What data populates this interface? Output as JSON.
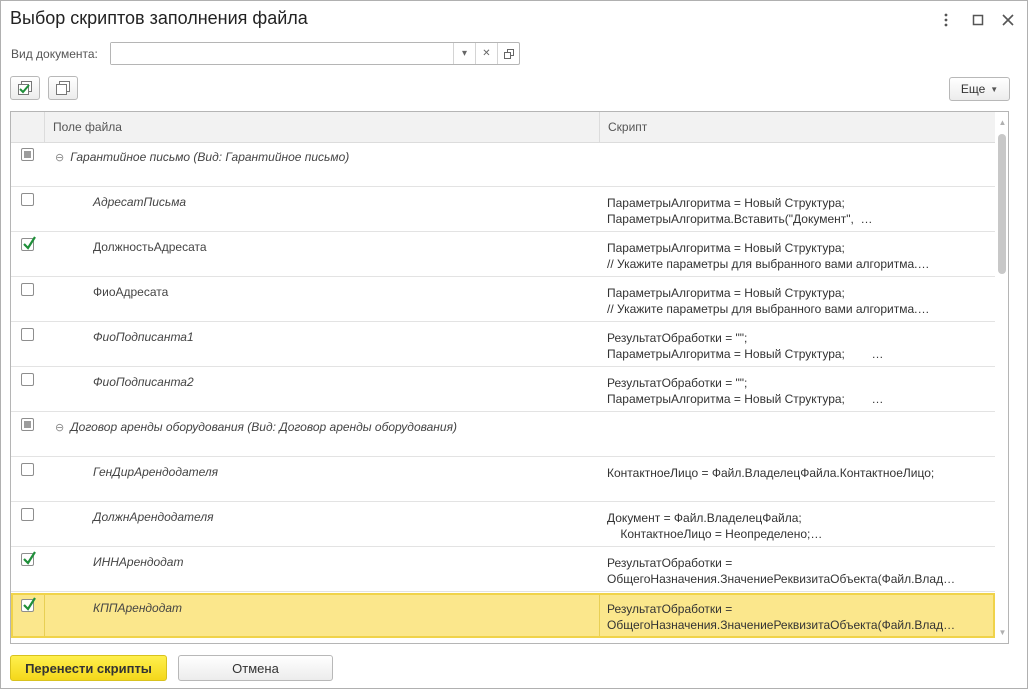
{
  "window": {
    "title": "Выбор скриптов заполнения файла"
  },
  "filter": {
    "label": "Вид документа:",
    "value": "",
    "placeholder": ""
  },
  "toolbar": {
    "more_label": "Еще"
  },
  "table": {
    "columns": [
      "Поле файла",
      "Скрипт"
    ],
    "groups": [
      {
        "title": "Гарантийное письмо (Вид: Гарантийное письмо)",
        "state": "partial",
        "rows": [
          {
            "field": "АдресатПисьма",
            "italic": true,
            "checked": false,
            "script": [
              "ПараметрыАлгоритма = Новый Структура;",
              "ПараметрыАлгоритма.Вставить(\"Документ\",  …"
            ]
          },
          {
            "field": "ДолжностьАдресата",
            "italic": false,
            "checked": true,
            "script": [
              "ПараметрыАлгоритма = Новый Структура;",
              "// Укажите параметры для выбранного вами алгоритма.…"
            ]
          },
          {
            "field": "ФиоАдресата",
            "italic": false,
            "checked": false,
            "script": [
              "ПараметрыАлгоритма = Новый Структура;",
              "// Укажите параметры для выбранного вами алгоритма.…"
            ]
          },
          {
            "field": "ФиоПодписанта1",
            "italic": true,
            "checked": false,
            "script": [
              "РезультатОбработки = \"\";",
              "ПараметрыАлгоритма = Новый Структура;        …"
            ]
          },
          {
            "field": "ФиоПодписанта2",
            "italic": true,
            "checked": false,
            "script": [
              "РезультатОбработки = \"\";",
              "ПараметрыАлгоритма = Новый Структура;        …"
            ]
          }
        ]
      },
      {
        "title": "Договор аренды оборудования (Вид: Договор аренды оборудования)",
        "state": "partial",
        "rows": [
          {
            "field": "ГенДирАрендодателя",
            "italic": true,
            "checked": false,
            "script": [
              "КонтактноеЛицо = Файл.ВладелецФайла.КонтактноеЛицо;"
            ]
          },
          {
            "field": "ДолжнАрендодателя",
            "italic": true,
            "checked": false,
            "script": [
              "Документ = Файл.ВладелецФайла;",
              "    КонтактноеЛицо = Неопределено;…"
            ]
          },
          {
            "field": "ИННАрендодат",
            "italic": true,
            "checked": true,
            "script": [
              "РезультатОбработки =",
              "ОбщегоНазначения.ЗначениеРеквизитаОбъекта(Файл.Влад…"
            ]
          },
          {
            "field": "КППАрендодат",
            "italic": true,
            "checked": true,
            "selected": true,
            "script": [
              "РезультатОбработки =",
              "ОбщегоНазначения.ЗначениеРеквизитаОбъекта(Файл.Влад…"
            ]
          }
        ]
      }
    ]
  },
  "buttons": {
    "transfer": "Перенести скрипты",
    "cancel": "Отмена"
  },
  "colors": {
    "accent": "#f4d71b",
    "selected_row": "#fbe78c",
    "check": "#1f8f3a"
  }
}
